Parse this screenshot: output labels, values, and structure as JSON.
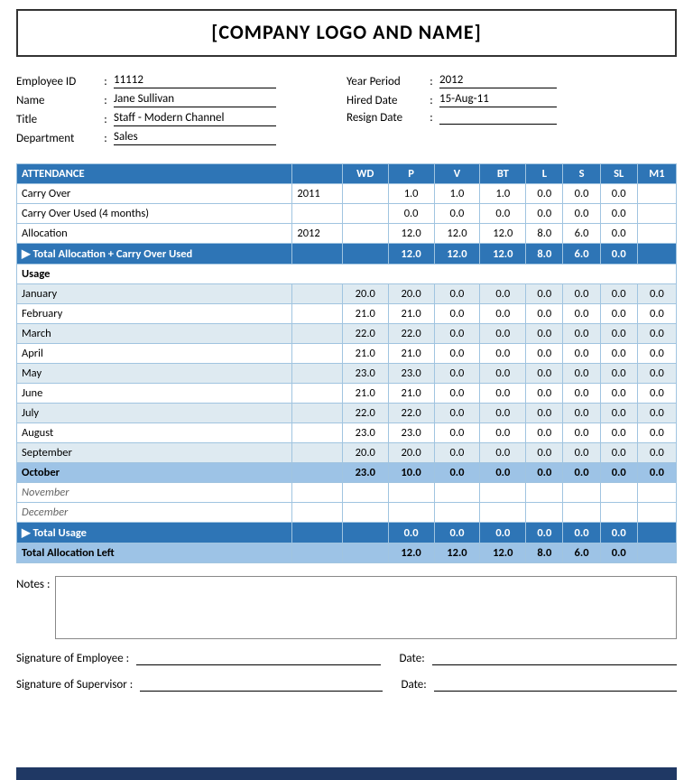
{
  "header": {
    "title": "[COMPANY LOGO AND NAME]"
  },
  "employee_info": {
    "left": [
      {
        "label": "Employee ID",
        "colon": ":",
        "value": "11112"
      },
      {
        "label": "Name",
        "colon": ":",
        "value": "Jane Sullivan"
      },
      {
        "label": "Title",
        "colon": ":",
        "value": "Staff - Modern Channel"
      },
      {
        "label": "Department",
        "colon": ":",
        "value": "Sales"
      }
    ],
    "right": [
      {
        "label": "Year Period",
        "colon": ":",
        "value": "2012"
      },
      {
        "label": "Hired Date",
        "colon": ":",
        "value": "15-Aug-11"
      },
      {
        "label": "Resign Date",
        "colon": ":",
        "value": ""
      }
    ]
  },
  "table": {
    "columns": [
      "ATTENDANCE",
      "",
      "WD",
      "P",
      "V",
      "BT",
      "L",
      "S",
      "SL",
      "M1"
    ],
    "carry_over": [
      "Carry Over",
      "2011",
      "",
      "1.0",
      "1.0",
      "1.0",
      "0.0",
      "0.0",
      "0.0",
      ""
    ],
    "carry_over_used": [
      "Carry Over Used (4 months)",
      "",
      "",
      "0.0",
      "0.0",
      "0.0",
      "0.0",
      "0.0",
      "0.0",
      ""
    ],
    "allocation": [
      "Allocation",
      "2012",
      "",
      "12.0",
      "12.0",
      "12.0",
      "8.0",
      "6.0",
      "0.0",
      ""
    ],
    "total_alloc": [
      "▶ Total Allocation + Carry Over Used",
      "",
      "",
      "12.0",
      "12.0",
      "12.0",
      "8.0",
      "6.0",
      "0.0",
      ""
    ],
    "usage_header": "Usage",
    "months": [
      {
        "name": "January",
        "wd": "20.0",
        "p": "20.0",
        "v": "0.0",
        "bt": "0.0",
        "l": "0.0",
        "s": "0.0",
        "sl": "0.0",
        "m1": "0.0",
        "style": "odd"
      },
      {
        "name": "February",
        "wd": "21.0",
        "p": "21.0",
        "v": "0.0",
        "bt": "0.0",
        "l": "0.0",
        "s": "0.0",
        "sl": "0.0",
        "m1": "0.0",
        "style": "even"
      },
      {
        "name": "March",
        "wd": "22.0",
        "p": "22.0",
        "v": "0.0",
        "bt": "0.0",
        "l": "0.0",
        "s": "0.0",
        "sl": "0.0",
        "m1": "0.0",
        "style": "odd"
      },
      {
        "name": "April",
        "wd": "21.0",
        "p": "21.0",
        "v": "0.0",
        "bt": "0.0",
        "l": "0.0",
        "s": "0.0",
        "sl": "0.0",
        "m1": "0.0",
        "style": "even"
      },
      {
        "name": "May",
        "wd": "23.0",
        "p": "23.0",
        "v": "0.0",
        "bt": "0.0",
        "l": "0.0",
        "s": "0.0",
        "sl": "0.0",
        "m1": "0.0",
        "style": "odd"
      },
      {
        "name": "June",
        "wd": "21.0",
        "p": "21.0",
        "v": "0.0",
        "bt": "0.0",
        "l": "0.0",
        "s": "0.0",
        "sl": "0.0",
        "m1": "0.0",
        "style": "even"
      },
      {
        "name": "July",
        "wd": "22.0",
        "p": "22.0",
        "v": "0.0",
        "bt": "0.0",
        "l": "0.0",
        "s": "0.0",
        "sl": "0.0",
        "m1": "0.0",
        "style": "odd"
      },
      {
        "name": "August",
        "wd": "23.0",
        "p": "23.0",
        "v": "0.0",
        "bt": "0.0",
        "l": "0.0",
        "s": "0.0",
        "sl": "0.0",
        "m1": "0.0",
        "style": "even"
      },
      {
        "name": "September",
        "wd": "20.0",
        "p": "20.0",
        "v": "0.0",
        "bt": "0.0",
        "l": "0.0",
        "s": "0.0",
        "sl": "0.0",
        "m1": "0.0",
        "style": "odd"
      },
      {
        "name": "October",
        "wd": "23.0",
        "p": "10.0",
        "v": "0.0",
        "bt": "0.0",
        "l": "0.0",
        "s": "0.0",
        "sl": "0.0",
        "m1": "0.0",
        "style": "oct"
      },
      {
        "name": "November",
        "wd": "",
        "p": "",
        "v": "",
        "bt": "",
        "l": "",
        "s": "",
        "sl": "",
        "m1": "",
        "style": "italic"
      },
      {
        "name": "December",
        "wd": "",
        "p": "",
        "v": "",
        "bt": "",
        "l": "",
        "s": "",
        "sl": "",
        "m1": "",
        "style": "italic"
      }
    ],
    "total_usage": [
      "▶ Total Usage",
      "",
      "",
      "0.0",
      "0.0",
      "0.0",
      "0.0",
      "0.0",
      "0.0",
      ""
    ],
    "total_alloc_left": [
      "Total Allocation Left",
      "",
      "",
      "12.0",
      "12.0",
      "12.0",
      "8.0",
      "6.0",
      "0.0",
      ""
    ]
  },
  "notes": {
    "label": "Notes :"
  },
  "signatures": [
    {
      "label": "Signature of Employee :",
      "date_label": "Date:"
    },
    {
      "label": "Signature of Supervisor :",
      "date_label": "Date:"
    }
  ]
}
